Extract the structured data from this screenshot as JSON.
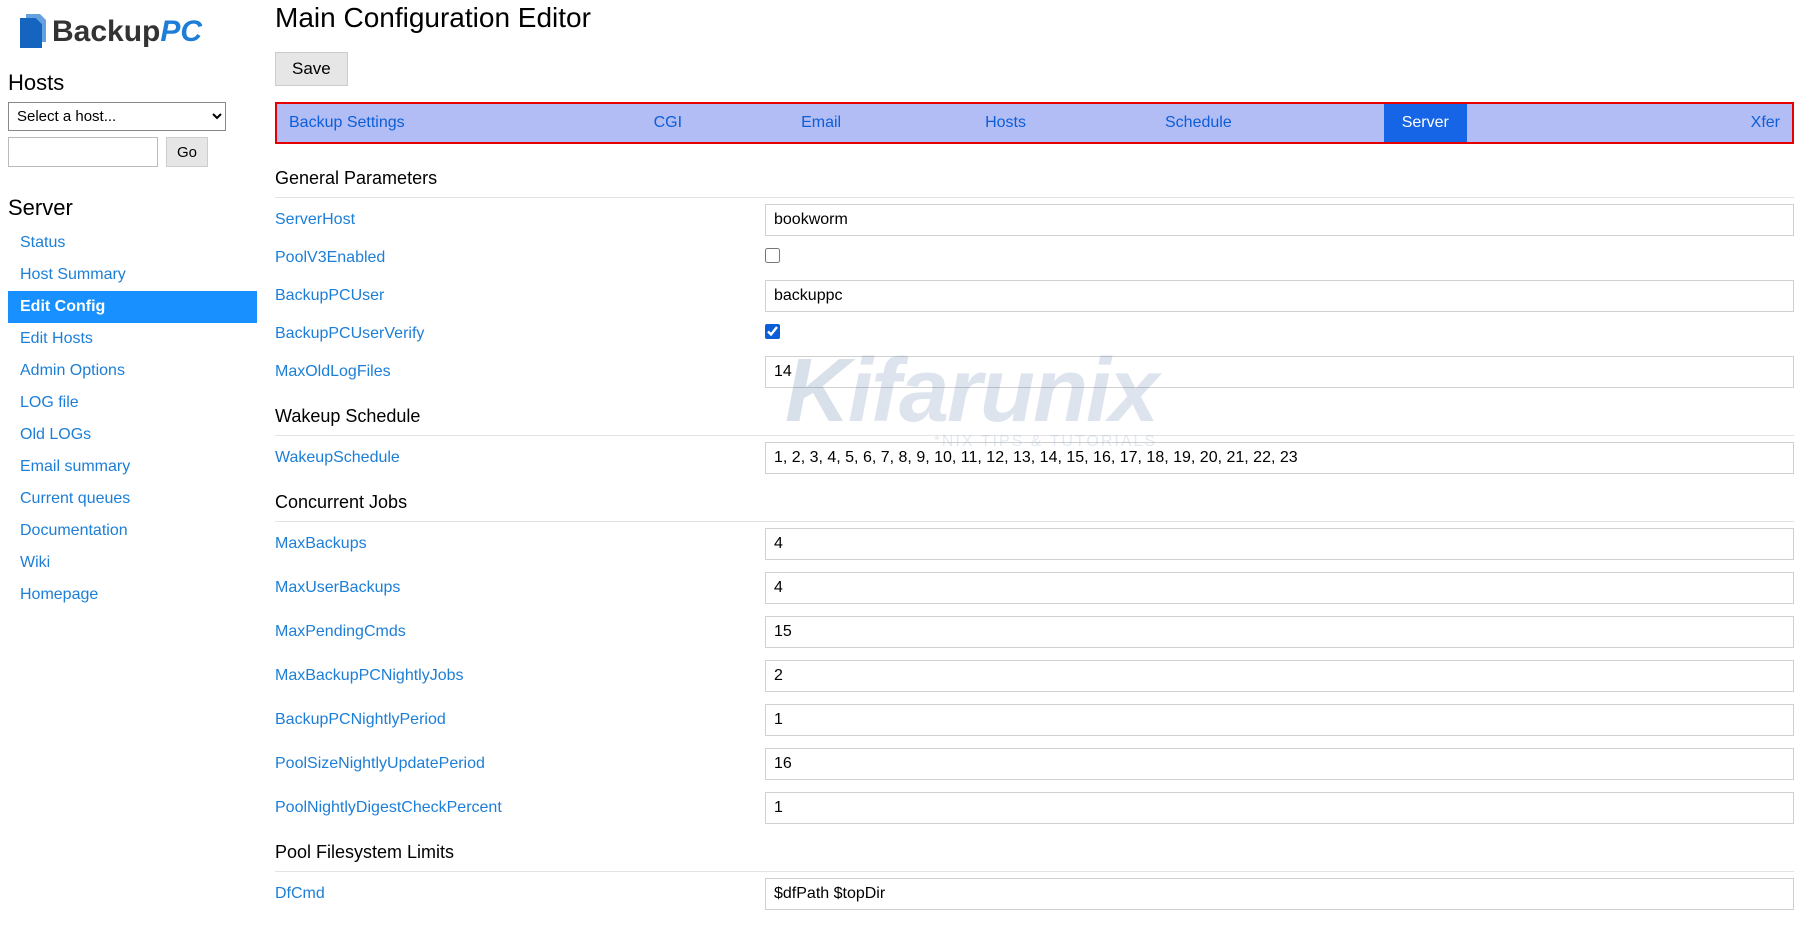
{
  "logo": {
    "text1": "Backup",
    "text2": "PC"
  },
  "sidebar": {
    "hosts_header": "Hosts",
    "select_placeholder": "Select a host...",
    "go_label": "Go",
    "server_header": "Server",
    "nav": [
      {
        "label": "Status",
        "active": false
      },
      {
        "label": "Host Summary",
        "active": false
      },
      {
        "label": "Edit Config",
        "active": true
      },
      {
        "label": "Edit Hosts",
        "active": false
      },
      {
        "label": "Admin Options",
        "active": false
      },
      {
        "label": "LOG file",
        "active": false
      },
      {
        "label": "Old LOGs",
        "active": false
      },
      {
        "label": "Email summary",
        "active": false
      },
      {
        "label": "Current queues",
        "active": false
      },
      {
        "label": "Documentation",
        "active": false
      },
      {
        "label": "Wiki",
        "active": false
      },
      {
        "label": "Homepage",
        "active": false
      }
    ]
  },
  "main": {
    "title": "Main Configuration Editor",
    "save_label": "Save",
    "tabs": [
      {
        "label": "Backup Settings",
        "active": false
      },
      {
        "label": "CGI",
        "active": false
      },
      {
        "label": "Email",
        "active": false
      },
      {
        "label": "Hosts",
        "active": false
      },
      {
        "label": "Schedule",
        "active": false
      },
      {
        "label": "Server",
        "active": true
      },
      {
        "label": "Xfer",
        "active": false
      }
    ],
    "sections": {
      "general": {
        "header": "General Parameters",
        "rows": [
          {
            "key": "ServerHost",
            "type": "text",
            "value": "bookworm"
          },
          {
            "key": "PoolV3Enabled",
            "type": "checkbox",
            "value": false
          },
          {
            "key": "BackupPCUser",
            "type": "text",
            "value": "backuppc"
          },
          {
            "key": "BackupPCUserVerify",
            "type": "checkbox",
            "value": true
          },
          {
            "key": "MaxOldLogFiles",
            "type": "text",
            "value": "14"
          }
        ]
      },
      "wakeup": {
        "header": "Wakeup Schedule",
        "rows": [
          {
            "key": "WakeupSchedule",
            "type": "text",
            "value": "1, 2, 3, 4, 5, 6, 7, 8, 9, 10, 11, 12, 13, 14, 15, 16, 17, 18, 19, 20, 21, 22, 23"
          }
        ]
      },
      "concurrent": {
        "header": "Concurrent Jobs",
        "rows": [
          {
            "key": "MaxBackups",
            "type": "text",
            "value": "4"
          },
          {
            "key": "MaxUserBackups",
            "type": "text",
            "value": "4"
          },
          {
            "key": "MaxPendingCmds",
            "type": "text",
            "value": "15"
          },
          {
            "key": "MaxBackupPCNightlyJobs",
            "type": "text",
            "value": "2"
          },
          {
            "key": "BackupPCNightlyPeriod",
            "type": "text",
            "value": "1"
          },
          {
            "key": "PoolSizeNightlyUpdatePeriod",
            "type": "text",
            "value": "16"
          },
          {
            "key": "PoolNightlyDigestCheckPercent",
            "type": "text",
            "value": "1"
          }
        ]
      },
      "pool": {
        "header": "Pool Filesystem Limits",
        "rows": [
          {
            "key": "DfCmd",
            "type": "text",
            "value": "$dfPath $topDir"
          }
        ]
      }
    }
  },
  "watermark": {
    "big": "Kifarunix",
    "sub": "*NIX TIPS & TUTORIALS"
  }
}
